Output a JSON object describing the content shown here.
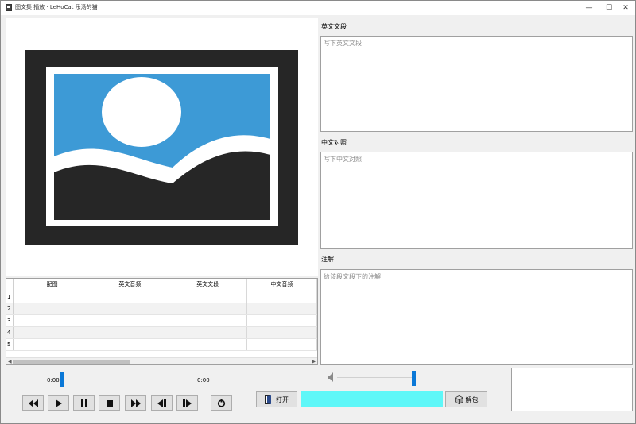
{
  "window": {
    "title": "图文集 播放 · LeHoCat 乐汤的猫",
    "minimize_glyph": "—",
    "maximize_glyph": "☐",
    "close_glyph": "✕"
  },
  "preview": {
    "icon": "image-placeholder-icon"
  },
  "table": {
    "headers": [
      "配图",
      "英文音频",
      "英文文段",
      "中文音频"
    ],
    "rows": [
      "1",
      "2",
      "3",
      "4",
      "5"
    ]
  },
  "english_section": {
    "label": "英文文段",
    "placeholder": "写下英文文段"
  },
  "chinese_section": {
    "label": "中文对照",
    "placeholder": "写下中文对照"
  },
  "notes_section": {
    "label": "注解",
    "placeholder": "给该段文段下的注解"
  },
  "player": {
    "current_time": "0:00",
    "total_time": "0:00",
    "position_fraction": 0.0,
    "buttons": [
      {
        "name": "rewind-button",
        "icon": "rewind-icon"
      },
      {
        "name": "play-button",
        "icon": "play-icon"
      },
      {
        "name": "pause-button",
        "icon": "pause-icon"
      },
      {
        "name": "stop-button",
        "icon": "stop-icon"
      },
      {
        "name": "fast-forward-button",
        "icon": "fast-forward-icon"
      },
      {
        "name": "previous-button",
        "icon": "skip-previous-icon"
      },
      {
        "name": "next-button",
        "icon": "skip-next-icon"
      },
      {
        "name": "reload-button",
        "icon": "refresh-icon"
      }
    ]
  },
  "volume": {
    "icon": "speaker-icon",
    "level_fraction": 1.0
  },
  "actions": {
    "open_label": "打开",
    "open_icon": "door-open-icon",
    "unpack_label": "解包",
    "unpack_icon": "package-icon",
    "accent_color": "#5ef7f8"
  }
}
